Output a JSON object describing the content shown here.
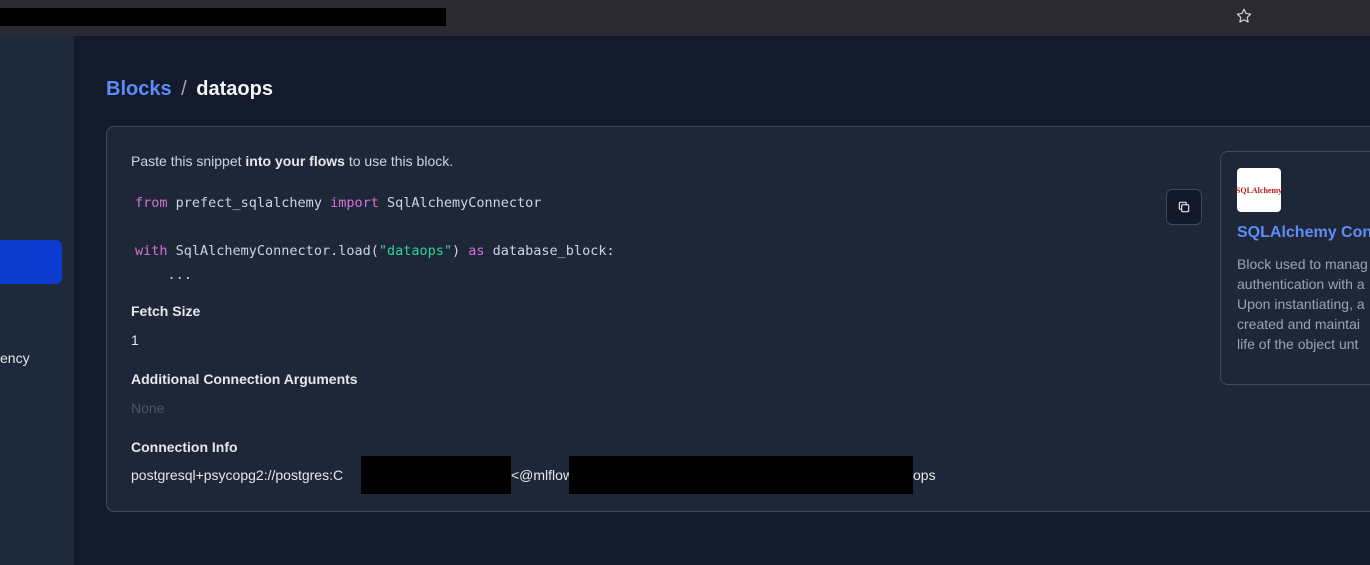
{
  "browser": {
    "bookmark_icon": "star-icon"
  },
  "sidebar": {
    "partial_item_label": "ency"
  },
  "breadcrumb": {
    "parent": "Blocks",
    "separator": "/",
    "current": "dataops"
  },
  "snippet": {
    "intro_before": "Paste this snippet ",
    "intro_bold": "into your flows",
    "intro_after": " to use this block.",
    "line1": {
      "kw1": "from",
      "module": " prefect_sqlalchemy ",
      "kw2": "import",
      "name": " SqlAlchemyConnector"
    },
    "line2": {
      "kw1": "with",
      "call": " SqlAlchemyConnector.load(",
      "arg": "\"dataops\"",
      "close": ") ",
      "kw2": "as",
      "rest": " database_block:"
    },
    "line3": "    ...",
    "copy_icon": "copy-icon"
  },
  "fields": {
    "fetch_size_label": "Fetch Size",
    "fetch_size_value": "1",
    "connect_args_label": "Additional Connection Arguments",
    "connect_args_value": "None",
    "connection_info_label": "Connection Info",
    "connection_info_seg1": "postgresql+psycopg2://postgres:C",
    "connection_info_seg3": "<@mlflow",
    "connection_info_seg5": "ops"
  },
  "block_type_card": {
    "logo_text": "SQLAlchemy",
    "title": "SQLAlchemy Con",
    "description_lines": [
      "Block used to manag",
      "authentication with a",
      "Upon instantiating, a",
      "created and maintai",
      "life of the object unt"
    ]
  }
}
